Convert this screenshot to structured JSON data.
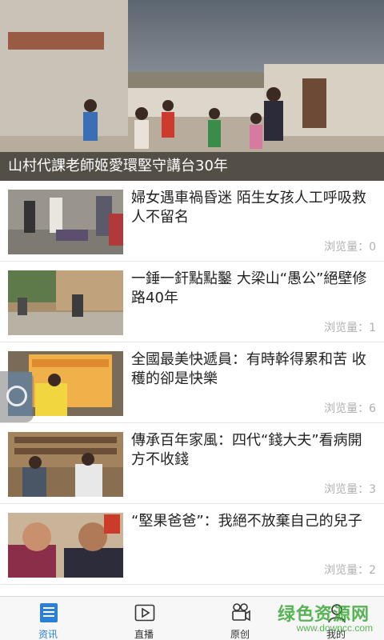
{
  "hero": {
    "caption": "山村代課老師姬愛環堅守講台30年"
  },
  "news": [
    {
      "title": "婦女遇車禍昏迷 陌生女孩人工呼吸救人不留名",
      "views_label": "浏览量：",
      "views": "0"
    },
    {
      "title": "一錘一釬點點鑿 大梁山“愚公”絕壁修路40年",
      "views_label": "浏览量：",
      "views": "1"
    },
    {
      "title": "全國最美快遞員：有時幹得累和苦 收穫的卻是快樂",
      "views_label": "浏览量：",
      "views": "6"
    },
    {
      "title": "傳承百年家風：四代“錢大夫”看病開方不收錢",
      "views_label": "浏览量：",
      "views": "3"
    },
    {
      "title": "“堅果爸爸”：我絕不放棄自己的兒子",
      "views_label": "浏览量：",
      "views": "2"
    }
  ],
  "tabs": [
    {
      "label": "资讯",
      "icon": "list-icon",
      "active": true
    },
    {
      "label": "直播",
      "icon": "play-icon",
      "active": false
    },
    {
      "label": "原创",
      "icon": "video-camera-icon",
      "active": false
    },
    {
      "label": "我的",
      "icon": "user-icon",
      "active": false
    }
  ],
  "watermark": {
    "name": "绿色资源网",
    "url": "www.downcc.com"
  },
  "colors": {
    "accent": "#2a7fd6",
    "watermark": "#3da838",
    "caption_bg": "#000000"
  }
}
